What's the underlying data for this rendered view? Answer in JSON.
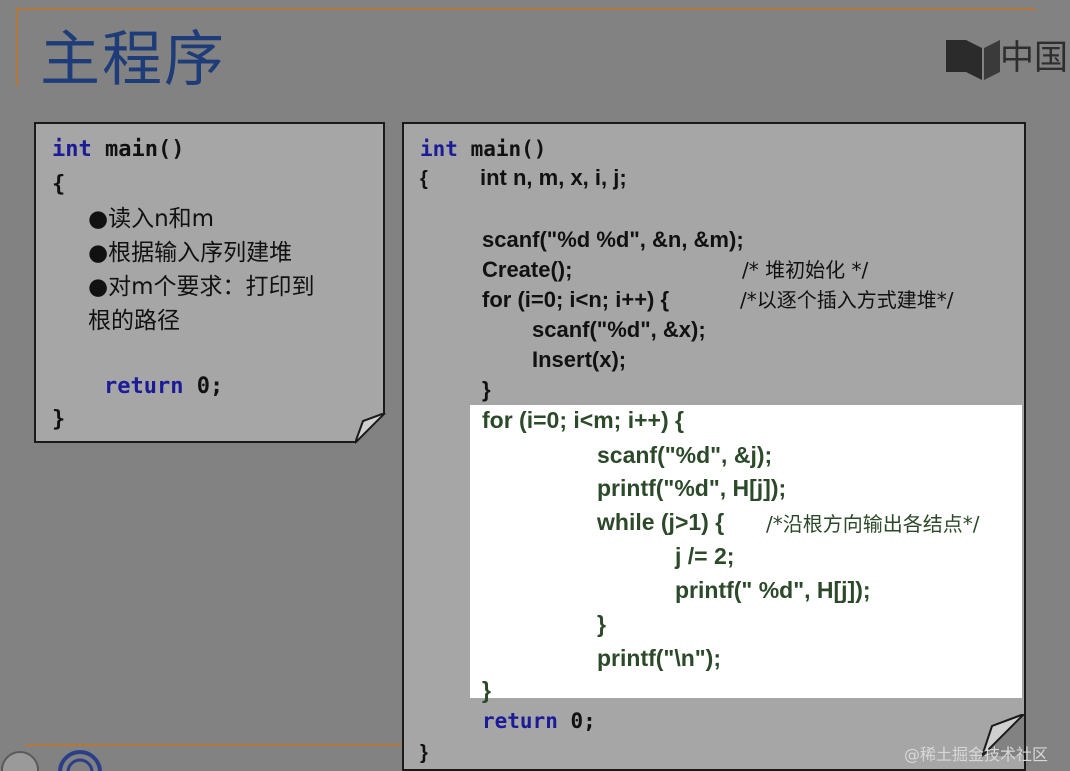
{
  "title": "主程序",
  "logo_text": "中国",
  "watermark": "@稀土掘金技术社区",
  "left_box": {
    "line1_kw": "int",
    "line1_rest": " main()",
    "line2": "{",
    "bullet1": "●读入n和m",
    "bullet2": "●根据输入序列建堆",
    "bullet3": "●对m个要求：打印到",
    "bullet3_cont": "根的路径",
    "return_kw": "return",
    "return_rest": " 0;",
    "close": "}"
  },
  "right_box": {
    "line1_kw": "int",
    "line1_rest": " main()",
    "brace_open": "{",
    "decl": "int n, m, x, i, j;",
    "scanf_nm": "scanf(\"%d %d\", &n, &m);",
    "create": "Create();",
    "create_comment": "/* 堆初始化 */",
    "for1": "for (i=0; i<n; i++) {",
    "for1_comment": "/*以逐个插入方式建堆*/",
    "scanf_x": "scanf(\"%d\", &x);",
    "insert": "Insert(x);",
    "close1": "}",
    "for2": "for (i=0; i<m; i++) {",
    "scanf_j": "scanf(\"%d\", &j);",
    "printf_hj": "printf(\"%d\", H[j]);",
    "while": "while (j>1) {",
    "while_comment": "/*沿根方向输出各结点*/",
    "j_div": "j /= 2;",
    "printf_hj2": "printf(\" %d\", H[j]);",
    "close_while": "}",
    "printf_nl": "printf(\"\\n\");",
    "close_for2": "}",
    "return_kw": "return",
    "return_rest": " 0;",
    "close_main": "}"
  }
}
